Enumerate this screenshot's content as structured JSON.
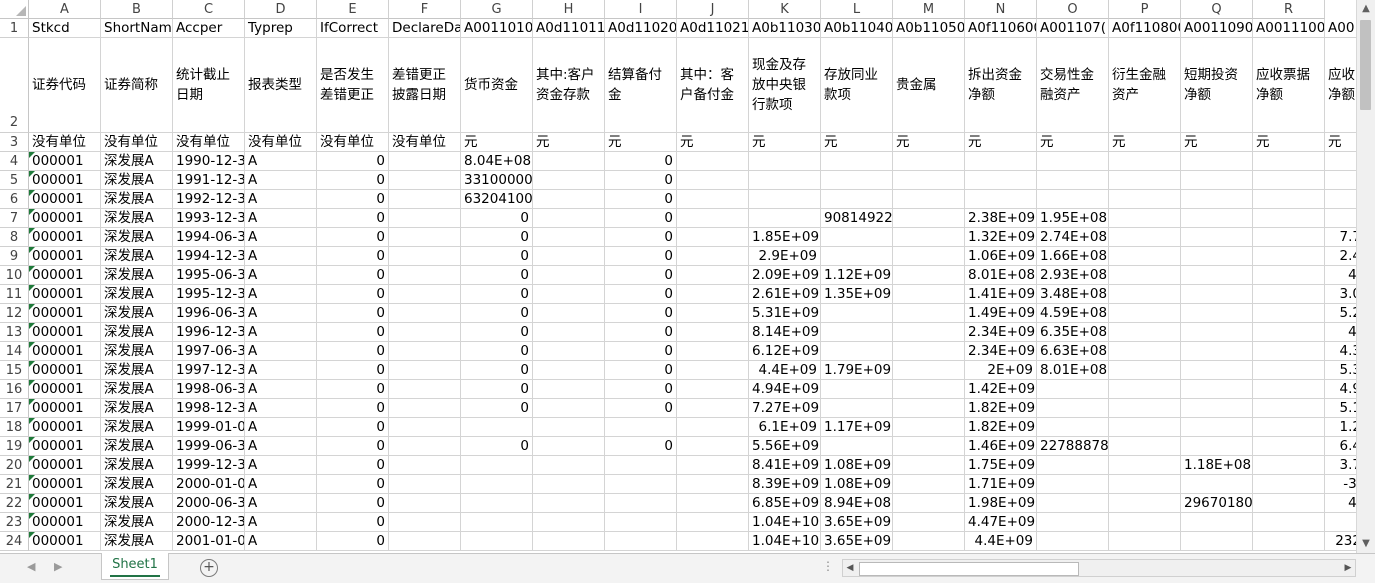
{
  "columns": [
    "A",
    "B",
    "C",
    "D",
    "E",
    "F",
    "G",
    "H",
    "I",
    "J",
    "K",
    "L",
    "M",
    "N",
    "O",
    "P",
    "Q",
    "R"
  ],
  "row_numbers": [
    "1",
    "2",
    "3",
    "4",
    "5",
    "6",
    "7",
    "8",
    "9",
    "10",
    "11",
    "12",
    "13",
    "14",
    "15",
    "16",
    "17",
    "18",
    "19",
    "20",
    "21",
    "22",
    "23",
    "24"
  ],
  "header_row": [
    "Stkcd",
    "ShortNam",
    "Accper",
    "Typrep",
    "IfCorrect",
    "DeclareDat",
    "A0011010(",
    "A0d11011(",
    "A0d11020(",
    "A0d11021(",
    "A0b11030(",
    "A0b11040(",
    "A0b11050(",
    "A0f110600",
    "A001107(",
    "A0f110800",
    "A0011090(",
    "A0011100(",
    "A00"
  ],
  "cn_row": [
    "证券代码",
    "证券简称",
    "统计截止日期",
    "报表类型",
    "是否发生差错更正",
    "差错更正披露日期",
    "货币资金",
    "其中:客户资金存款",
    "结算备付金",
    "其中：客户备付金",
    "现金及存放中央银行款项",
    "存放同业款项",
    "贵金属",
    "拆出资金净额",
    "交易性金融资产",
    "衍生金融资产",
    "短期投资净额",
    "应收票据净额",
    "应收净额"
  ],
  "unit_row": [
    "没有单位",
    "没有单位",
    "没有单位",
    "没有单位",
    "没有单位",
    "没有单位",
    "元",
    "元",
    "元",
    "元",
    "元",
    "元",
    "元",
    "元",
    "元",
    "元",
    "元",
    "元",
    "元"
  ],
  "data_rows": [
    [
      "000001",
      "深发展A",
      "1990-12-3",
      "A",
      "0",
      "",
      "8.04E+08",
      "",
      "0",
      "",
      "",
      "",
      "",
      "",
      "",
      "",
      "",
      "",
      ""
    ],
    [
      "000001",
      "深发展A",
      "1991-12-3",
      "A",
      "0",
      "",
      "33100000",
      "",
      "0",
      "",
      "",
      "",
      "",
      "",
      "",
      "",
      "",
      "",
      ""
    ],
    [
      "000001",
      "深发展A",
      "1992-12-3",
      "A",
      "0",
      "",
      "63204100",
      "",
      "0",
      "",
      "",
      "",
      "",
      "",
      "",
      "",
      "",
      "",
      ""
    ],
    [
      "000001",
      "深发展A",
      "1993-12-3",
      "A",
      "0",
      "",
      "0",
      "",
      "0",
      "",
      "",
      "90814922",
      "",
      "2.38E+09",
      "1.95E+08",
      "",
      "",
      "",
      ""
    ],
    [
      "000001",
      "深发展A",
      "1994-06-3",
      "A",
      "0",
      "",
      "0",
      "",
      "0",
      "",
      "1.85E+09",
      "",
      "",
      "1.32E+09",
      "2.74E+08",
      "",
      "",
      "",
      "7.7"
    ],
    [
      "000001",
      "深发展A",
      "1994-12-3",
      "A",
      "0",
      "",
      "0",
      "",
      "0",
      "",
      "2.9E+09",
      "",
      "",
      "1.06E+09",
      "1.66E+08",
      "",
      "",
      "",
      "2.4"
    ],
    [
      "000001",
      "深发展A",
      "1995-06-3",
      "A",
      "0",
      "",
      "0",
      "",
      "0",
      "",
      "2.09E+09",
      "1.12E+09",
      "",
      "8.01E+08",
      "2.93E+08",
      "",
      "",
      "",
      "4."
    ],
    [
      "000001",
      "深发展A",
      "1995-12-3",
      "A",
      "0",
      "",
      "0",
      "",
      "0",
      "",
      "2.61E+09",
      "1.35E+09",
      "",
      "1.41E+09",
      "3.48E+08",
      "",
      "",
      "",
      "3.0"
    ],
    [
      "000001",
      "深发展A",
      "1996-06-3",
      "A",
      "0",
      "",
      "0",
      "",
      "0",
      "",
      "5.31E+09",
      "",
      "",
      "1.49E+09",
      "4.59E+08",
      "",
      "",
      "",
      "5.2"
    ],
    [
      "000001",
      "深发展A",
      "1996-12-3",
      "A",
      "0",
      "",
      "0",
      "",
      "0",
      "",
      "8.14E+09",
      "",
      "",
      "2.34E+09",
      "6.35E+08",
      "",
      "",
      "",
      "4."
    ],
    [
      "000001",
      "深发展A",
      "1997-06-3",
      "A",
      "0",
      "",
      "0",
      "",
      "0",
      "",
      "6.12E+09",
      "",
      "",
      "2.34E+09",
      "6.63E+08",
      "",
      "",
      "",
      "4.3"
    ],
    [
      "000001",
      "深发展A",
      "1997-12-3",
      "A",
      "0",
      "",
      "0",
      "",
      "0",
      "",
      "4.4E+09",
      "1.79E+09",
      "",
      "2E+09",
      "8.01E+08",
      "",
      "",
      "",
      "5.3"
    ],
    [
      "000001",
      "深发展A",
      "1998-06-3",
      "A",
      "0",
      "",
      "0",
      "",
      "0",
      "",
      "4.94E+09",
      "",
      "",
      "1.42E+09",
      "",
      "",
      "",
      "",
      "4.9"
    ],
    [
      "000001",
      "深发展A",
      "1998-12-3",
      "A",
      "0",
      "",
      "0",
      "",
      "0",
      "",
      "7.27E+09",
      "",
      "",
      "1.82E+09",
      "",
      "",
      "",
      "",
      "5.1"
    ],
    [
      "000001",
      "深发展A",
      "1999-01-0",
      "A",
      "0",
      "",
      "",
      "",
      "",
      "",
      "6.1E+09",
      "1.17E+09",
      "",
      "1.82E+09",
      "",
      "",
      "",
      "",
      "1.2"
    ],
    [
      "000001",
      "深发展A",
      "1999-06-3",
      "A",
      "0",
      "",
      "0",
      "",
      "0",
      "",
      "5.56E+09",
      "",
      "",
      "1.46E+09",
      "22788878",
      "",
      "",
      "",
      "6.4"
    ],
    [
      "000001",
      "深发展A",
      "1999-12-3",
      "A",
      "0",
      "",
      "",
      "",
      "",
      "",
      "8.41E+09",
      "1.08E+09",
      "",
      "1.75E+09",
      "",
      "",
      "1.18E+08",
      "",
      "3.7"
    ],
    [
      "000001",
      "深发展A",
      "2000-01-0",
      "A",
      "0",
      "",
      "",
      "",
      "",
      "",
      "8.39E+09",
      "1.08E+09",
      "",
      "1.71E+09",
      "",
      "",
      "",
      "",
      "-3."
    ],
    [
      "000001",
      "深发展A",
      "2000-06-3",
      "A",
      "0",
      "",
      "",
      "",
      "",
      "",
      "6.85E+09",
      "8.94E+08",
      "",
      "1.98E+09",
      "",
      "",
      "29670180",
      "",
      "4."
    ],
    [
      "000001",
      "深发展A",
      "2000-12-3",
      "A",
      "0",
      "",
      "",
      "",
      "",
      "",
      "1.04E+10",
      "3.65E+09",
      "",
      "4.47E+09",
      "",
      "",
      "",
      "",
      "-"
    ],
    [
      "000001",
      "深发展A",
      "2001-01-0",
      "A",
      "0",
      "",
      "",
      "",
      "",
      "",
      "1.04E+10",
      "3.65E+09",
      "",
      "4.4E+09",
      "",
      "",
      "",
      "",
      "232"
    ]
  ],
  "sheet_tab": "Sheet1",
  "icons": {
    "add_sheet": "plus-circle-icon",
    "scroll_up": "up-arrow",
    "scroll_down": "down-arrow"
  }
}
